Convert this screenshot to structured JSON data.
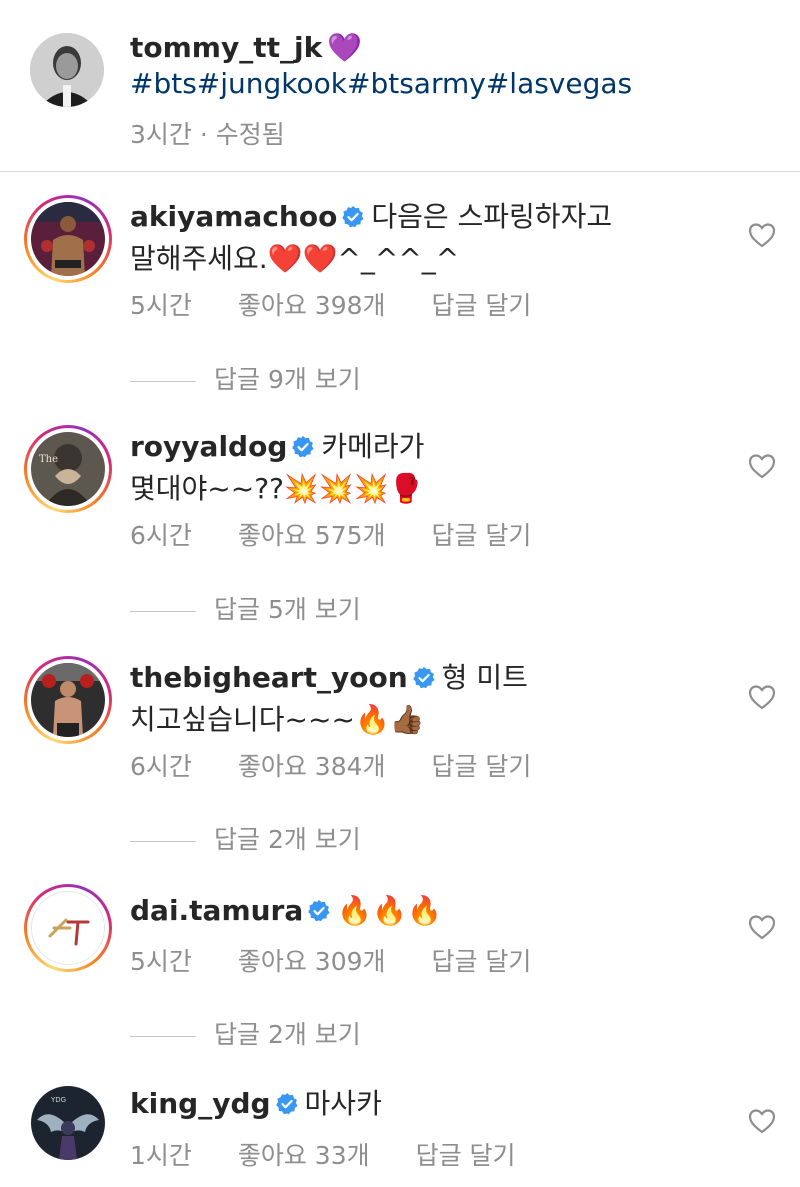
{
  "caption": {
    "username": "tommy_tt_jk",
    "emoji": "💜",
    "hashtags": "#bts#jungkook#btsarmy#lasvegas",
    "time_edited": "3시간 · 수정됨"
  },
  "comments": [
    {
      "username": "akiyamachoo",
      "verified": true,
      "line1": "다음은 스파링하자고",
      "line2": "말해주세요.❤️❤️^_^^_^",
      "time": "5시간",
      "likes": "좋아요 398개",
      "reply": "답글 달기",
      "view_replies": "답글 9개 보기",
      "avatar_icon": "fighter-photo-avatar"
    },
    {
      "username": "royyaldog",
      "verified": true,
      "line1": "카메라가",
      "line2": "몇대야~~??💥💥💥🥊",
      "time": "6시간",
      "likes": "좋아요 575개",
      "reply": "답글 달기",
      "view_replies": "답글 5개 보기",
      "avatar_icon": "hand-heart-avatar"
    },
    {
      "username": "thebigheart_yoon",
      "verified": true,
      "line1": "형 미트",
      "line2": "치고싶습니다~~~🔥👍🏾",
      "time": "6시간",
      "likes": "좋아요 384개",
      "reply": "답글 달기",
      "view_replies": "답글 2개 보기",
      "avatar_icon": "boxer-photo-avatar"
    },
    {
      "username": "dai.tamura",
      "verified": true,
      "line1": "🔥🔥🔥",
      "line2": "",
      "time": "5시간",
      "likes": "좋아요 309개",
      "reply": "답글 달기",
      "view_replies": "답글 2개 보기",
      "avatar_icon": "logo-avatar"
    },
    {
      "username": "king_ydg",
      "verified": true,
      "line1": "마사카",
      "line2": "",
      "time": "1시간",
      "likes": "좋아요 33개",
      "reply": "답글 달기",
      "view_replies": "",
      "avatar_icon": "wings-photo-avatar"
    }
  ],
  "colors": {
    "verified": "#3897f0",
    "hashtag": "#00376b",
    "meta": "#8e8e8e"
  }
}
